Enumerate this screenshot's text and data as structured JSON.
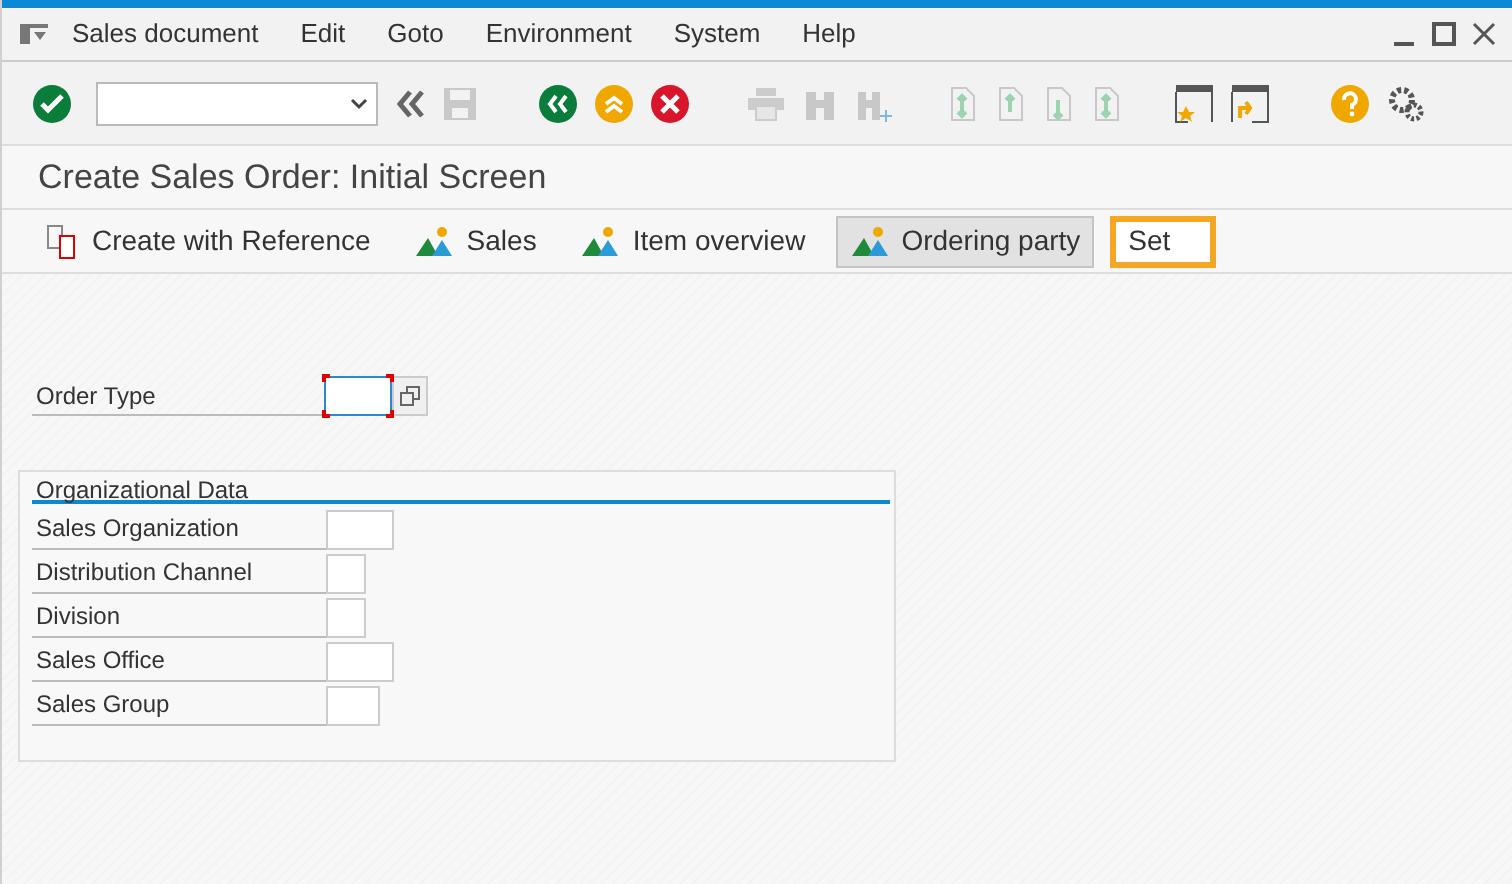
{
  "menu": [
    "Sales document",
    "Edit",
    "Goto",
    "Environment",
    "System",
    "Help"
  ],
  "screen_title": "Create Sales Order: Initial Screen",
  "app_toolbar": [
    {
      "label": "Create with Reference",
      "kind": "reference",
      "pressed": false,
      "focused": false
    },
    {
      "label": "Sales",
      "kind": "overview",
      "pressed": false,
      "focused": false
    },
    {
      "label": "Item overview",
      "kind": "overview",
      "pressed": false,
      "focused": false
    },
    {
      "label": "Ordering party",
      "kind": "overview",
      "pressed": true,
      "focused": false
    },
    {
      "label": "Set",
      "kind": "plain",
      "pressed": false,
      "focused": true
    }
  ],
  "order_type": {
    "label": "Order Type",
    "focused": true
  },
  "organizational_data": {
    "title": "Organizational Data",
    "fields": [
      {
        "label": "Sales Organization"
      },
      {
        "label": "Distribution Channel"
      },
      {
        "label": "Division"
      },
      {
        "label": "Sales Office"
      },
      {
        "label": "Sales Group"
      }
    ]
  }
}
